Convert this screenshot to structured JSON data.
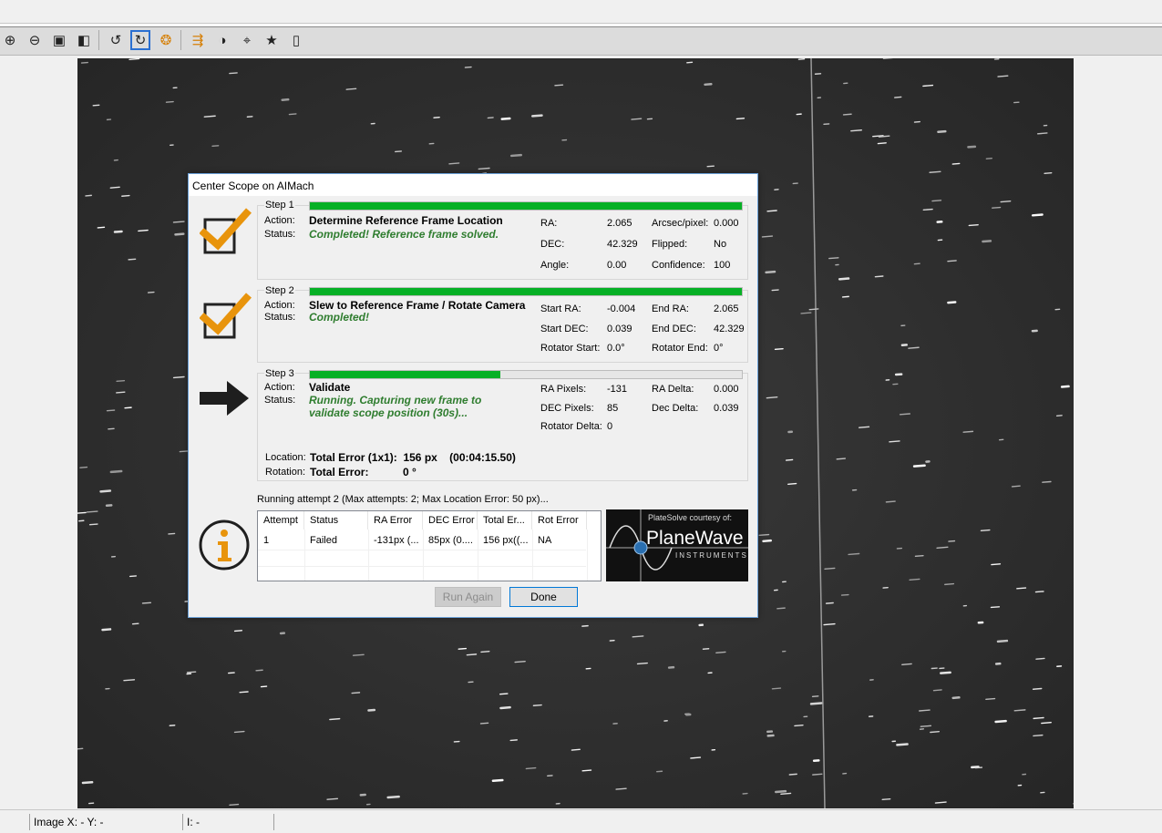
{
  "toolbar": {
    "buttons": [
      {
        "name": "zoom-in-icon",
        "glyph": "⊕"
      },
      {
        "name": "zoom-out-icon",
        "glyph": "⊖"
      },
      {
        "name": "zoom-fit-icon",
        "glyph": "▣"
      },
      {
        "name": "zoom-actual-icon",
        "glyph": "◧"
      },
      {
        "name": "rotate-left-icon",
        "glyph": "↺"
      },
      {
        "name": "rotate-right-icon",
        "glyph": "↻"
      },
      {
        "name": "auto-stretch-icon",
        "glyph": "❂"
      },
      {
        "name": "histogram-icon",
        "glyph": "⇶"
      },
      {
        "name": "contrast-icon",
        "glyph": "◑"
      },
      {
        "name": "crosshair-icon",
        "glyph": "⌖"
      },
      {
        "name": "star-icon",
        "glyph": "★"
      },
      {
        "name": "panel-icon",
        "glyph": "▯"
      }
    ]
  },
  "dialog": {
    "title": "Center Scope on AIMach",
    "step1": {
      "label": "Step 1",
      "progress": 1.0,
      "action_label": "Action:",
      "action_value": "Determine Reference Frame Location",
      "status_label": "Status:",
      "status_value": "Completed!  Reference frame solved.",
      "fields": [
        {
          "label": "RA:",
          "value": "2.065"
        },
        {
          "label": "Arcsec/pixel:",
          "value": "0.000"
        },
        {
          "label": "DEC:",
          "value": "42.329"
        },
        {
          "label": "Flipped:",
          "value": "No"
        },
        {
          "label": "Angle:",
          "value": "0.00"
        },
        {
          "label": "Confidence:",
          "value": "100"
        }
      ]
    },
    "step2": {
      "label": "Step 2",
      "progress": 1.0,
      "action_label": "Action:",
      "action_value": "Slew to Reference Frame / Rotate Camera",
      "status_label": "Status:",
      "status_value": "Completed!",
      "fields": [
        {
          "label": "Start RA:",
          "value": "-0.004"
        },
        {
          "label": "End RA:",
          "value": "2.065"
        },
        {
          "label": "Start DEC:",
          "value": "0.039"
        },
        {
          "label": "End DEC:",
          "value": "42.329"
        },
        {
          "label": "Rotator Start:",
          "value": "0.0°"
        },
        {
          "label": "Rotator End:",
          "value": "0°"
        }
      ]
    },
    "step3": {
      "label": "Step 3",
      "progress": 0.44,
      "action_label": "Action:",
      "action_value": "Validate",
      "status_label": "Status:",
      "status_line1": "Running.  Capturing new frame to",
      "status_line2": "validate scope position (30s)...",
      "fields": [
        {
          "label": "RA Pixels:",
          "value": "-131"
        },
        {
          "label": "RA Delta:",
          "value": "0.000"
        },
        {
          "label": "DEC Pixels:",
          "value": "85"
        },
        {
          "label": "Dec Delta:",
          "value": "0.039"
        },
        {
          "label": "Rotator Delta:",
          "value": "0"
        }
      ],
      "location_label": "Location:",
      "location_value": "Total Error (1x1):  156 px    (00:04:15.50)",
      "rotation_label": "Rotation:",
      "rotation_title": "Total Error:",
      "rotation_value": "0 °"
    },
    "attempt_status": "Running attempt 2 (Max attempts: 2; Max Location Error: 50 px)...",
    "table": {
      "columns": [
        "Attempt",
        "Status",
        "RA Error",
        "DEC Error",
        "Total Er...",
        "Rot Error"
      ],
      "rows": [
        [
          "1",
          "Failed",
          "-131px (...",
          "85px (0....",
          "156 px((...",
          "NA"
        ]
      ]
    },
    "logo": {
      "tagline": "PlateSolve courtesy of:",
      "brand": "PlaneWave",
      "sub": "INSTRUMENTS"
    },
    "buttons": {
      "run_again": "Run Again",
      "done": "Done"
    },
    "colors": {
      "progress_green": "#06b025",
      "check_orange": "#e8940c",
      "status_green": "#2f7d2f"
    }
  },
  "statusbar": {
    "coords": "Image X: - Y: -",
    "intensity": "I: -"
  }
}
